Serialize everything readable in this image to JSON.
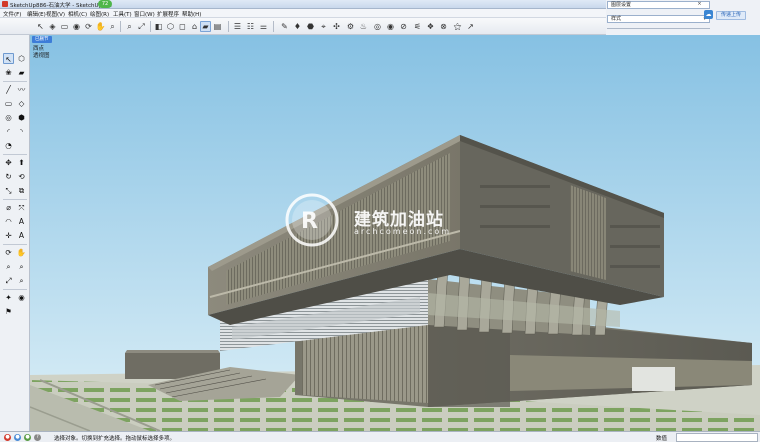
{
  "titlebar": {
    "title": "SketchUp886-石油大学 - SketchUp Mo",
    "badge": "72"
  },
  "menu": {
    "items": [
      "文件(F)",
      "编辑(E)",
      "视图(V)",
      "相机(C)",
      "绘图(R)",
      "工具(T)",
      "窗口(W)",
      "扩展程序",
      "帮助(H)"
    ]
  },
  "toolbar_icons": [
    "select-icon",
    "make-component-icon",
    "eraser-icon",
    "paint-bucket-icon",
    "orbit-icon",
    "pan-icon",
    "zoom-icon",
    "zoom-window-icon",
    "zoom-extents-icon",
    "previous-view-icon",
    "scenes-icon",
    "iso-view-icon",
    "top-view-icon",
    "front-view-icon",
    "right-view-icon",
    "back-view-icon",
    "left-view-icon",
    "xray-icon",
    "back-edges-icon",
    "wireframe-icon",
    "hidden-line-icon",
    "shaded-icon",
    "shaded-texture-icon",
    "monochrome-icon",
    "section-plane-icon",
    "display-section-icon",
    "section-cuts-icon",
    "axes-icon",
    "guides-icon",
    "model-info-icon",
    "layers-icon",
    "outliner-icon",
    "materials-icon",
    "components-icon",
    "styles-icon",
    "fog-icon",
    "shadows-icon",
    "soften-edges-icon",
    "match-photo-icon",
    "entity-info-icon",
    "plugin-icon"
  ],
  "tray": {
    "title": "图层设置",
    "style_label": "样式",
    "upload_label": "传递上传",
    "close_glyph": "×"
  },
  "scene": {
    "tab": "已删节",
    "labels": [
      "西点",
      "透视图"
    ]
  },
  "watermark": {
    "text": "建筑加油站",
    "sub": "archcomeon.com"
  },
  "status": {
    "text": "选择对象。切换到扩充选择。拖动鼠标选择多项。",
    "measure_label": "数值",
    "measure_value": ""
  },
  "colors": {
    "sky_top": "#8cc4e4",
    "sky_bottom": "#d8eef7",
    "accent": "#3b86d3",
    "ground": "#cdd2c4"
  }
}
